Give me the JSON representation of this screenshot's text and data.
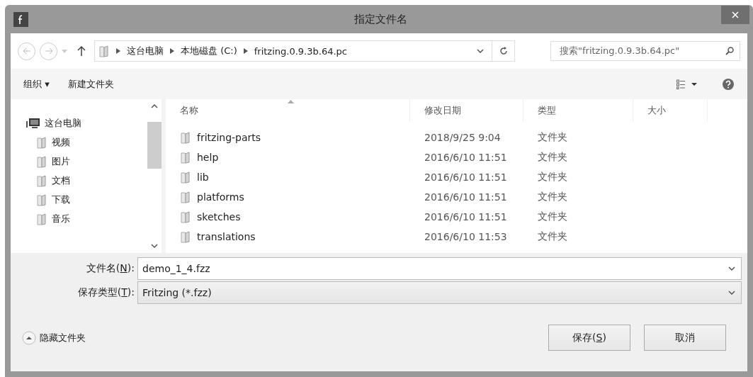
{
  "window": {
    "title": "指定文件名"
  },
  "address_bar": {
    "crumbs": [
      "这台电脑",
      "本地磁盘 (C:)",
      "fritzing.0.9.3b.64.pc"
    ]
  },
  "search": {
    "placeholder": "搜索\"fritzing.0.9.3b.64.pc\""
  },
  "toolbar": {
    "organize": "组织 ▾",
    "new_folder": "新建文件夹"
  },
  "sidebar": {
    "items": [
      {
        "label": "这台电脑",
        "children": [
          {
            "label": "视频"
          },
          {
            "label": "图片"
          },
          {
            "label": "文档"
          },
          {
            "label": "下载"
          },
          {
            "label": "音乐"
          }
        ]
      }
    ]
  },
  "table": {
    "columns": [
      {
        "label": "名称",
        "sorted": true
      },
      {
        "label": "修改日期",
        "sorted": false
      },
      {
        "label": "类型",
        "sorted": false
      },
      {
        "label": "大小",
        "sorted": false
      }
    ],
    "rows": [
      {
        "name": "fritzing-parts",
        "modified": "2018/9/25 9:04",
        "type": "文件夹",
        "selected": false
      },
      {
        "name": "help",
        "modified": "2016/6/10 11:51",
        "type": "文件夹",
        "selected": false
      },
      {
        "name": "lib",
        "modified": "2016/6/10 11:51",
        "type": "文件夹",
        "selected": false
      },
      {
        "name": "platforms",
        "modified": "2016/6/10 11:51",
        "type": "文件夹",
        "selected": false
      },
      {
        "name": "sketches",
        "modified": "2016/6/10 11:51",
        "type": "文件夹",
        "selected": false
      },
      {
        "name": "translations",
        "modified": "2016/6/10 11:53",
        "type": "文件夹",
        "selected": false
      }
    ]
  },
  "filename": {
    "label": {
      "before": "文件名(",
      "key": "N",
      "after": "):"
    },
    "value": "demo_1_4.fzz"
  },
  "filetype": {
    "label": {
      "before": "保存类型(",
      "key": "T",
      "after": "):"
    },
    "value": "Fritzing (*.fzz)"
  },
  "hide_folders": "隐藏文件夹",
  "buttons": [
    {
      "label": {
        "before": "保存(",
        "key": "S",
        "after": ")"
      }
    },
    {
      "label": "取消"
    }
  ]
}
